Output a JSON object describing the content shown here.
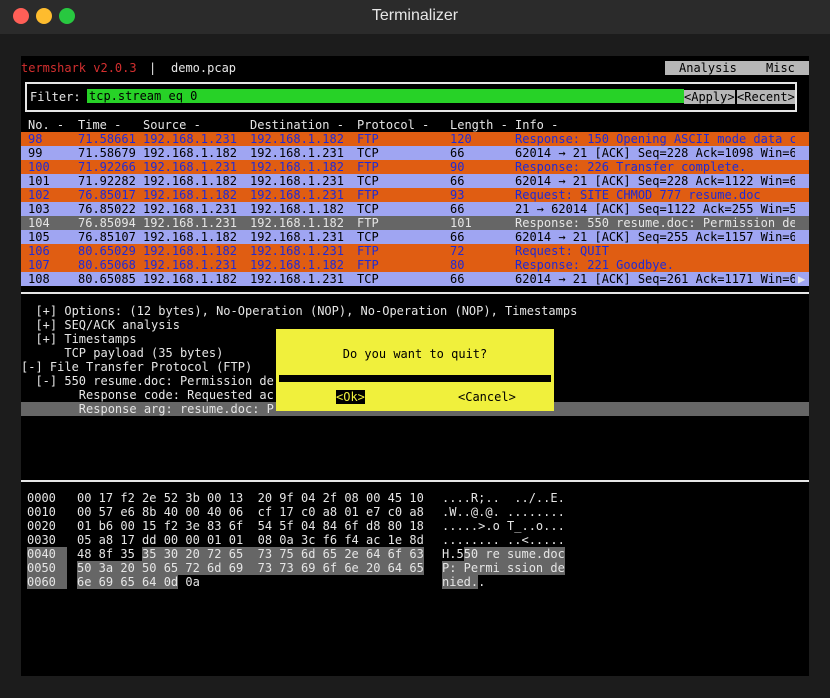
{
  "window": {
    "title": "Terminalizer"
  },
  "app": {
    "name": "termshark v2.0.3",
    "separator": "|",
    "file": "demo.pcap"
  },
  "menu": {
    "analysis": "Analysis",
    "misc": "Misc"
  },
  "filter": {
    "label": "Filter:",
    "value": "tcp.stream eq 0",
    "apply": "<Apply>",
    "recent": "<Recent>"
  },
  "columns": [
    "No. -",
    "Time -",
    "Source -",
    "Destination -",
    "Protocol -",
    "Length -",
    "Info -"
  ],
  "packets": [
    {
      "no": "98",
      "time": "71.58661",
      "src": "192.168.1.231",
      "dst": "192.168.1.182",
      "proto": "FTP",
      "len": "120",
      "info": "Response: 150 Opening ASCII mode data c",
      "kind": "ftp"
    },
    {
      "no": "99",
      "time": "71.58679",
      "src": "192.168.1.182",
      "dst": "192.168.1.231",
      "proto": "TCP",
      "len": "66",
      "info": "62014 → 21 [ACK] Seq=228 Ack=1098 Win=6",
      "kind": "tcp"
    },
    {
      "no": "100",
      "time": "71.92266",
      "src": "192.168.1.231",
      "dst": "192.168.1.182",
      "proto": "FTP",
      "len": "90",
      "info": "Response: 226 Transfer complete.",
      "kind": "ftp"
    },
    {
      "no": "101",
      "time": "71.92282",
      "src": "192.168.1.182",
      "dst": "192.168.1.231",
      "proto": "TCP",
      "len": "66",
      "info": "62014 → 21 [ACK] Seq=228 Ack=1122 Win=6",
      "kind": "tcp"
    },
    {
      "no": "102",
      "time": "76.85017",
      "src": "192.168.1.182",
      "dst": "192.168.1.231",
      "proto": "FTP",
      "len": "93",
      "info": "Request: SITE CHMOD 777 resume.doc",
      "kind": "ftp"
    },
    {
      "no": "103",
      "time": "76.85022",
      "src": "192.168.1.231",
      "dst": "192.168.1.182",
      "proto": "TCP",
      "len": "66",
      "info": "21 → 62014 [ACK] Seq=1122 Ack=255 Win=5",
      "kind": "tcp"
    },
    {
      "no": "104",
      "time": "76.85094",
      "src": "192.168.1.231",
      "dst": "192.168.1.182",
      "proto": "FTP",
      "len": "101",
      "info": "Response: 550 resume.doc: Permission de",
      "kind": "sel"
    },
    {
      "no": "105",
      "time": "76.85107",
      "src": "192.168.1.182",
      "dst": "192.168.1.231",
      "proto": "TCP",
      "len": "66",
      "info": "62014 → 21 [ACK] Seq=255 Ack=1157 Win=6",
      "kind": "tcp"
    },
    {
      "no": "106",
      "time": "80.65029",
      "src": "192.168.1.182",
      "dst": "192.168.1.231",
      "proto": "FTP",
      "len": "72",
      "info": "Request: QUIT",
      "kind": "ftp"
    },
    {
      "no": "107",
      "time": "80.65068",
      "src": "192.168.1.231",
      "dst": "192.168.1.182",
      "proto": "FTP",
      "len": "80",
      "info": "Response: 221 Goodbye.",
      "kind": "ftp"
    },
    {
      "no": "108",
      "time": "80.65085",
      "src": "192.168.1.182",
      "dst": "192.168.1.231",
      "proto": "TCP",
      "len": "66",
      "info": "62014 → 21 [ACK] Seq=261 Ack=1171 Win=6",
      "kind": "tcp"
    }
  ],
  "scroll_arrow": "▶",
  "detail_lines": [
    {
      "text": "  [+] Options: (12 bytes), No-Operation (NOP), No-Operation (NOP), Timestamps",
      "hl": false
    },
    {
      "text": "  [+] SEQ/ACK analysis",
      "hl": false
    },
    {
      "text": "  [+] Timestamps",
      "hl": false
    },
    {
      "text": "      TCP payload (35 bytes)",
      "hl": false
    },
    {
      "text": "[-] File Transfer Protocol (FTP)",
      "hl": false
    },
    {
      "text": "  [-] 550 resume.doc: Permission de",
      "hl": false
    },
    {
      "text": "        Response code: Requested ac",
      "hl": false
    },
    {
      "text": "        Response arg: resume.doc: P",
      "hl": true
    }
  ],
  "hex_rows": [
    {
      "off": "0000",
      "b1": "00 17 f2 2e 52 3b 00 13",
      "b2": "20 9f 04 2f 08 00 45 10",
      "asc": "....R;..  ../..E.",
      "hl": false
    },
    {
      "off": "0010",
      "b1": "00 57 e6 8b 40 00 40 06",
      "b2": "cf 17 c0 a8 01 e7 c0 a8",
      "asc": ".W..@.@. ........",
      "hl": false
    },
    {
      "off": "0020",
      "b1": "01 b6 00 15 f2 3e 83 6f",
      "b2": "54 5f 04 84 6f d8 80 18",
      "asc": ".....>.o T_..o...",
      "hl": false
    },
    {
      "off": "0030",
      "b1": "05 a8 17 dd 00 00 01 01",
      "b2": "08 0a 3c f6 f4 ac 1e 8d",
      "asc": "........ ..<.....",
      "hl": false
    },
    {
      "off": "0040",
      "b1a": "48 8f 35 ",
      "b1b": "35 30 20 72 65",
      "b2": "73 75 6d 65 2e 64 6f 63",
      "asca": "H.5",
      "ascb": "50 re sume.doc",
      "hl": "partial"
    },
    {
      "off": "0050",
      "b1": "50 3a 20 50 65 72 6d 69",
      "b2": "73 73 69 6f 6e 20 64 65",
      "asc": "P: Permi ssion de",
      "hl": true
    },
    {
      "off": "0060",
      "b1": "6e 69 65 64 0d",
      "b1tail": " 0a",
      "asc": "nied.",
      "asctail": ".",
      "hl": "last"
    }
  ],
  "dialog": {
    "question": "Do you want to quit?",
    "ok": "<Ok>",
    "cancel": "<Cancel>"
  }
}
